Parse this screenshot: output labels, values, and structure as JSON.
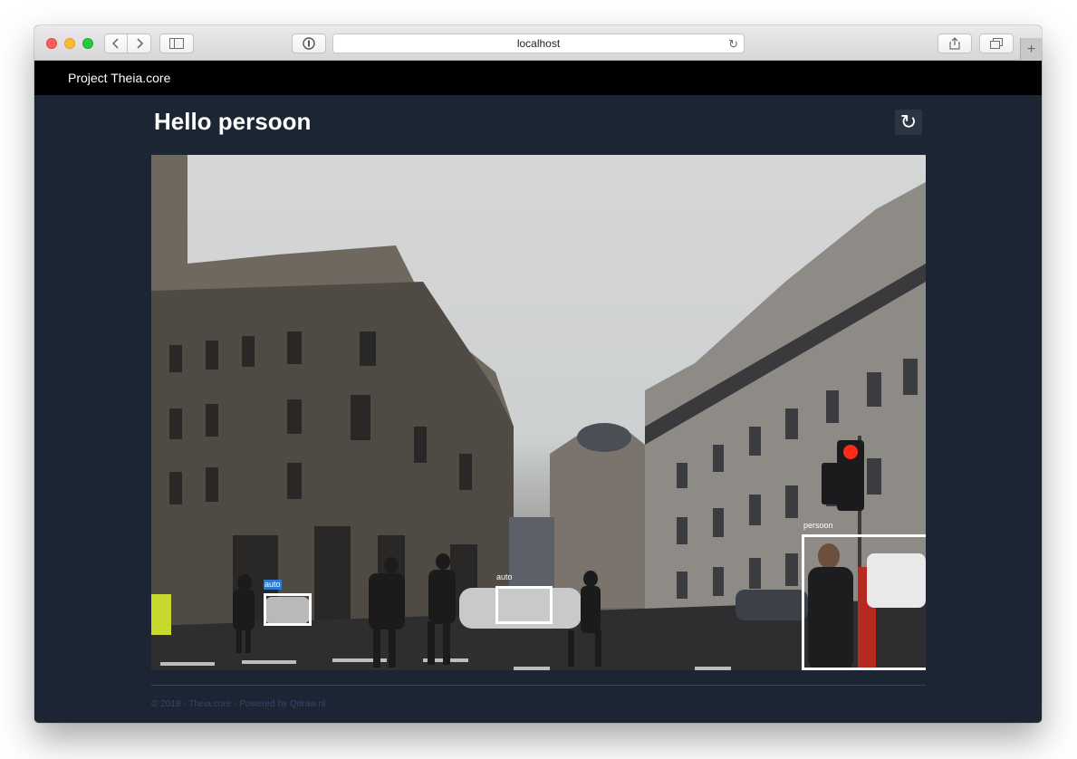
{
  "browser": {
    "url": "localhost",
    "back_icon": "chevron-left-icon",
    "forward_icon": "chevron-right-icon",
    "sidebar_icon": "sidebar-icon",
    "reader_icon": "reader-icon",
    "reload_icon": "reload-icon",
    "share_icon": "share-icon",
    "tabs_icon": "tabs-icon",
    "new_tab_icon": "plus-icon"
  },
  "navbar": {
    "brand": "Project Theia.core"
  },
  "main": {
    "title": "Hello persoon",
    "refresh_icon": "refresh-icon"
  },
  "detections": [
    {
      "label": "auto"
    },
    {
      "label": "auto"
    },
    {
      "label": "persoon"
    }
  ],
  "footer": {
    "text": "© 2018 - Theia.core - Powered by Qdraw.nl"
  },
  "colors": {
    "page_background": "#1c2533",
    "navbar_background": "#000000",
    "detection_box": "#ffffff",
    "footer_text": "#34476a"
  }
}
